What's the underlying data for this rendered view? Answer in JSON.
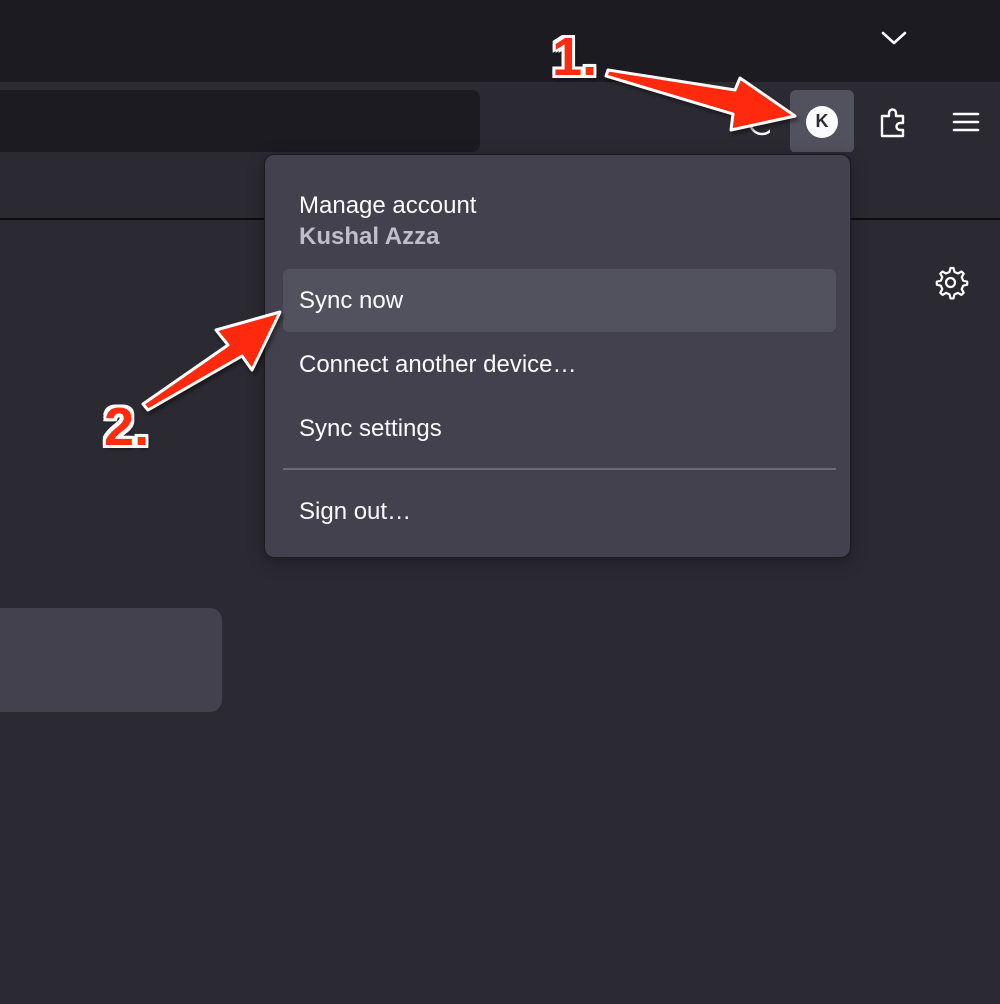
{
  "colors": {
    "background": "#2b2a33",
    "tabstrip": "#1c1b22",
    "menu": "#42414d",
    "menu_hover": "#52525e",
    "annotation": "#ff2a0f"
  },
  "toolbar": {
    "account_avatar_letter": "K",
    "icons": [
      "chevron-down-icon",
      "avatar-icon",
      "extensions-puzzle-icon",
      "hamburger-menu-icon",
      "gear-icon"
    ]
  },
  "account_menu": {
    "manage_account_label": "Manage account",
    "account_name": "Kushal Azza",
    "items": [
      {
        "label": "Sync now",
        "hovered": true
      },
      {
        "label": "Connect another device…",
        "hovered": false
      },
      {
        "label": "Sync settings",
        "hovered": false
      }
    ],
    "sign_out_label": "Sign out…"
  },
  "annotations": {
    "step1": "1.",
    "step2": "2."
  }
}
